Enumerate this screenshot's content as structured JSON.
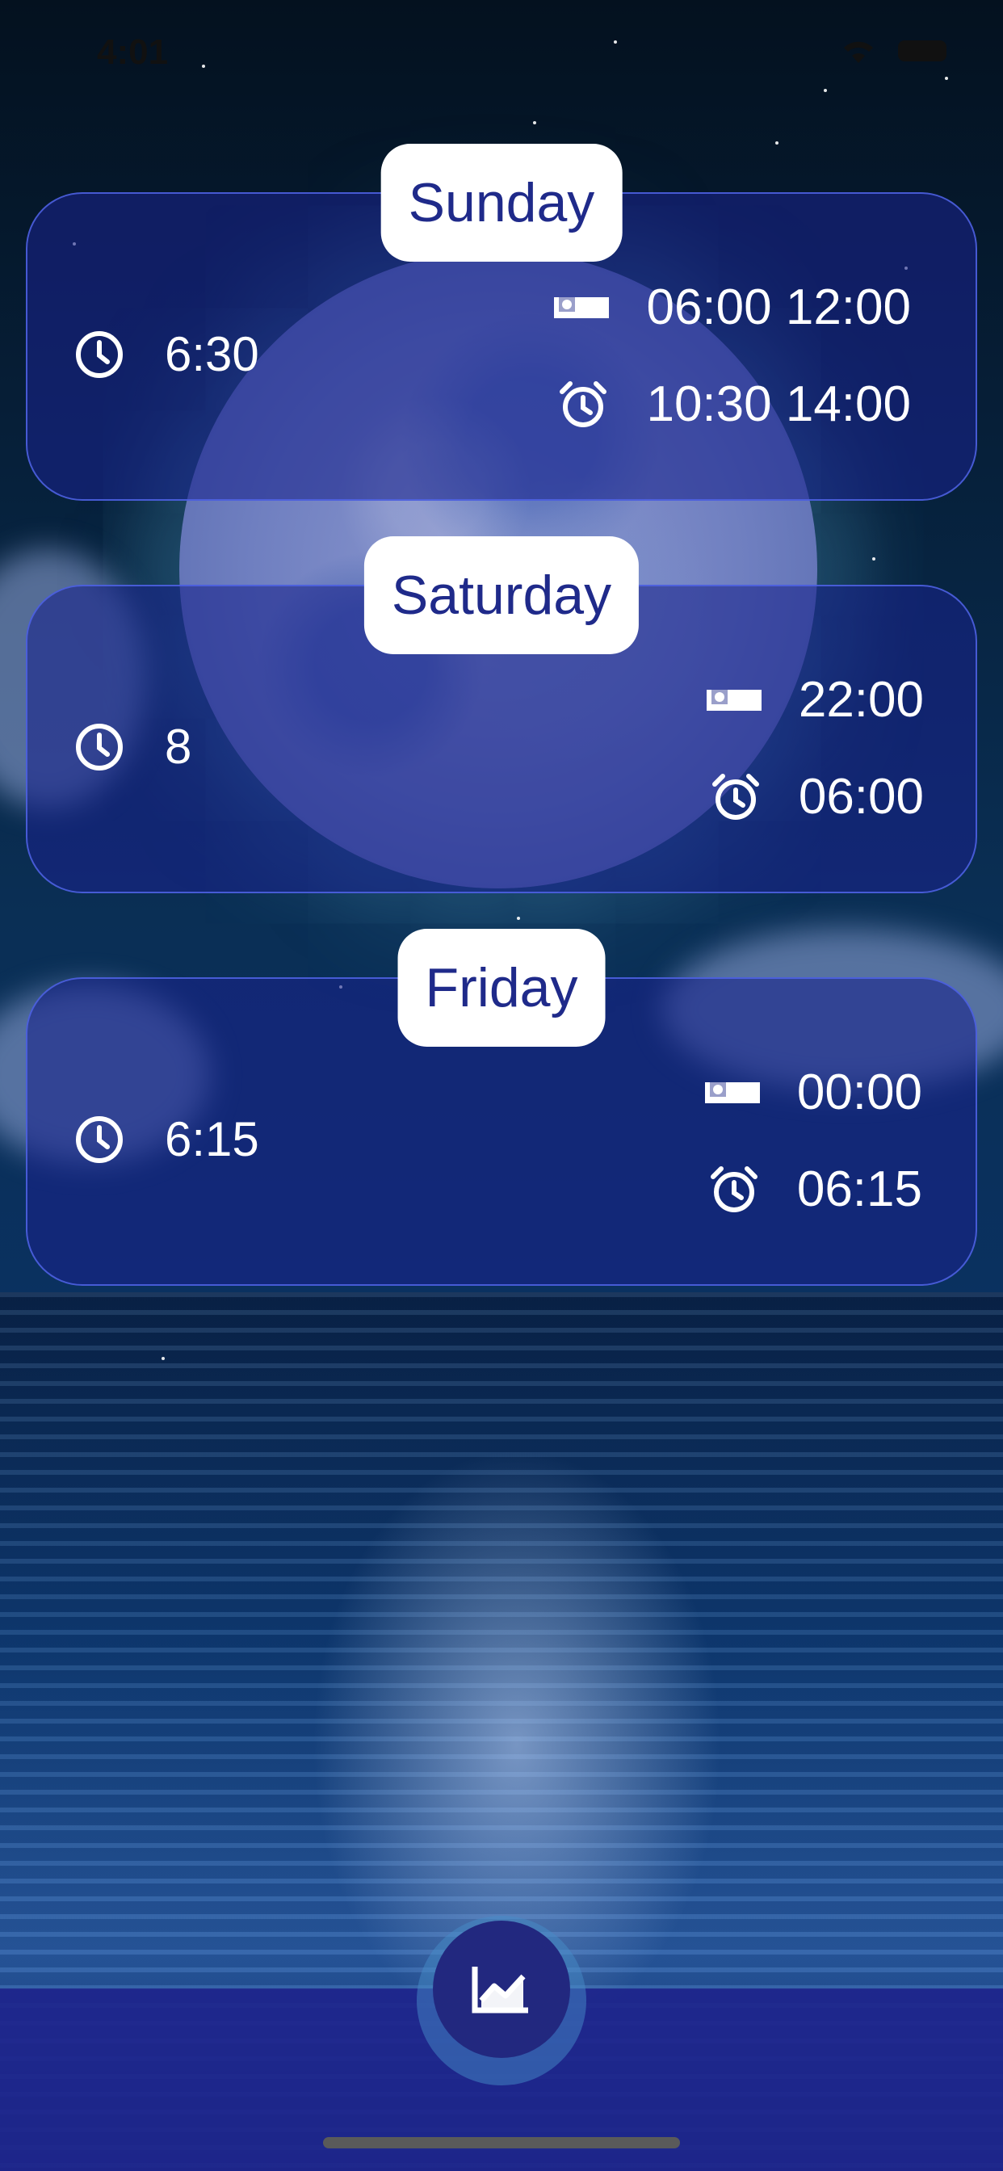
{
  "status_bar": {
    "time": "4:01"
  },
  "sleep_cards": [
    {
      "day": "Sunday",
      "duration": "6:30",
      "bed_time": "06:00 12:00",
      "wake_time": "10:30 14:00"
    },
    {
      "day": "Saturday",
      "duration": "8",
      "bed_time": "22:00",
      "wake_time": "06:00"
    },
    {
      "day": "Friday",
      "duration": "6:15",
      "bed_time": "00:00",
      "wake_time": "06:15"
    }
  ],
  "icons": {
    "duration": "clock-icon",
    "bed": "bed-icon",
    "wake": "alarm-clock-icon",
    "fab": "trending-chart-icon",
    "status": [
      "wifi-icon",
      "battery-icon"
    ]
  },
  "colors": {
    "card_background": "#18228c",
    "card_border": "#5064e6",
    "pill_text": "#1f2a8a",
    "bottom_bar": "#1e248c",
    "fab": "#22287f"
  }
}
